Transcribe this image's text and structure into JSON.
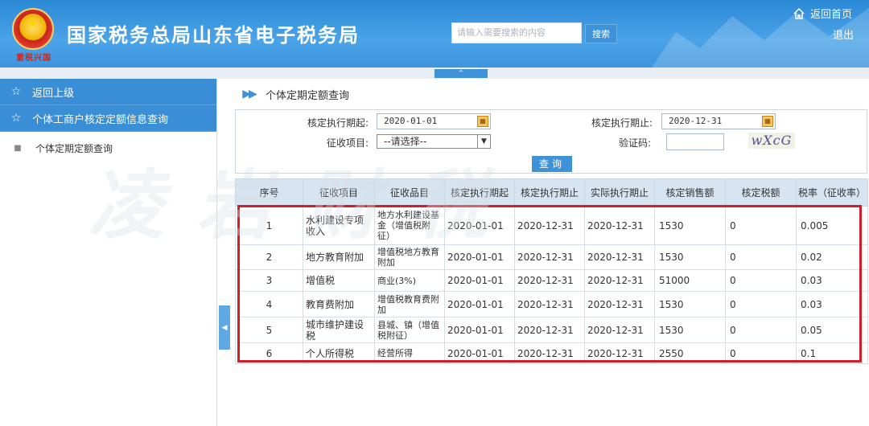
{
  "header": {
    "emblem_text": "重税兴国",
    "title": "国家税务总局山东省电子税务局",
    "search_placeholder": "请输入需要搜索的内容",
    "search_button": "搜索",
    "home_link": "返回首页",
    "exit_link": "退出"
  },
  "collapse_tab": "^",
  "sidebar": {
    "items": [
      {
        "label": "返回上级",
        "icon": "star-outline-icon"
      },
      {
        "label": "个体工商户核定定额信息查询",
        "icon": "star-outline-icon"
      }
    ],
    "sub_item": "个体定期定额查询"
  },
  "page": {
    "heading": "个体定期定额查询"
  },
  "form": {
    "start_label": "核定执行期起:",
    "start_value": "2020-01-01",
    "end_label": "核定执行期止:",
    "end_value": "2020-12-31",
    "collect_label": "征收项目:",
    "collect_value": "--请选择--",
    "captcha_label": "验证码:",
    "captcha_text": "wXcG",
    "query_button": "查询"
  },
  "table": {
    "headers": [
      "序号",
      "征收项目",
      "征收品目",
      "核定执行期起",
      "核定执行期止",
      "实际执行期止",
      "核定销售额",
      "核定税额",
      "税率（征收率）"
    ],
    "rows": [
      [
        "1",
        "水利建设专项收入",
        "地方水利建设基金（增值税附征）",
        "2020-01-01",
        "2020-12-31",
        "2020-12-31",
        "1530",
        "0",
        "0.005"
      ],
      [
        "2",
        "地方教育附加",
        "增值税地方教育附加",
        "2020-01-01",
        "2020-12-31",
        "2020-12-31",
        "1530",
        "0",
        "0.02"
      ],
      [
        "3",
        "增值税",
        "商业(3%)",
        "2020-01-01",
        "2020-12-31",
        "2020-12-31",
        "51000",
        "0",
        "0.03"
      ],
      [
        "4",
        "教育费附加",
        "增值税教育费附加",
        "2020-01-01",
        "2020-12-31",
        "2020-12-31",
        "1530",
        "0",
        "0.03"
      ],
      [
        "5",
        "城市维护建设税",
        "县城、镇（增值税附征）",
        "2020-01-01",
        "2020-12-31",
        "2020-12-31",
        "1530",
        "0",
        "0.05"
      ],
      [
        "6",
        "个人所得税",
        "经营所得",
        "2020-01-01",
        "2020-12-31",
        "2020-12-31",
        "2550",
        "0",
        "0.1"
      ]
    ]
  },
  "watermark": "凌岩财税",
  "colors": {
    "header_blue": "#3d95de",
    "sidebar_blue": "#3a8ed6",
    "highlight_red": "#d11f2a",
    "table_header": "#d7e4f1"
  }
}
